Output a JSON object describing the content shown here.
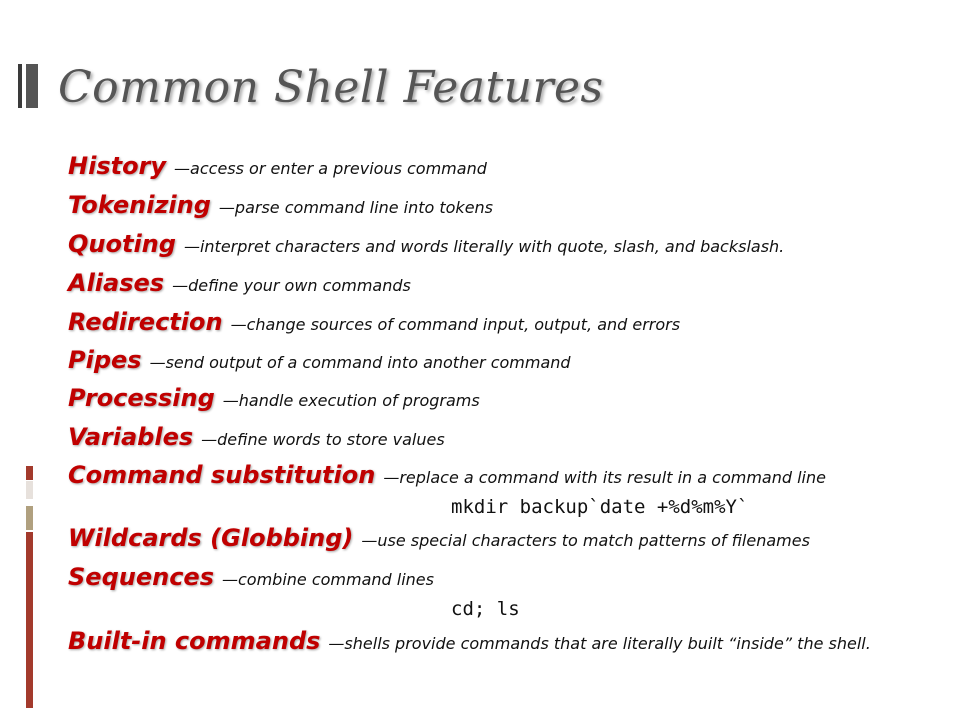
{
  "slide": {
    "title": "Common Shell Features"
  },
  "features": [
    {
      "term": "History",
      "desc": "—access or enter a previous command"
    },
    {
      "term": "Tokenizing",
      "desc": "—parse command line into tokens"
    },
    {
      "term": "Quoting",
      "desc": "—interpret characters and words literally with quote,  slash, and backslash."
    },
    {
      "term": "Aliases",
      "desc": "—define your own commands"
    },
    {
      "term": "Redirection",
      "desc": "—change sources of command input, output, and errors"
    },
    {
      "term": "Pipes",
      "desc": "—send output of a command into another command"
    },
    {
      "term": "Processing",
      "desc": "—handle execution of programs"
    },
    {
      "term": "Variables",
      "desc": "—define words to store values"
    },
    {
      "term": "Command substitution",
      "desc": "—replace a command with its result in a command line"
    },
    {
      "term": "Wildcards (Globbing)",
      "desc": "—use special characters to match patterns of filenames"
    },
    {
      "term": "Sequences",
      "desc": "—combine command lines"
    },
    {
      "term": "Built-in commands",
      "desc": "—shells provide commands that are literally built  “inside” the shell."
    }
  ],
  "examples": {
    "command_substitution": "mkdir backup`date +%d%m%Y`",
    "sequences": "cd; ls"
  },
  "colors": {
    "term": "#c00000",
    "title": "#555555",
    "accent_bar": "#a33a2c"
  }
}
